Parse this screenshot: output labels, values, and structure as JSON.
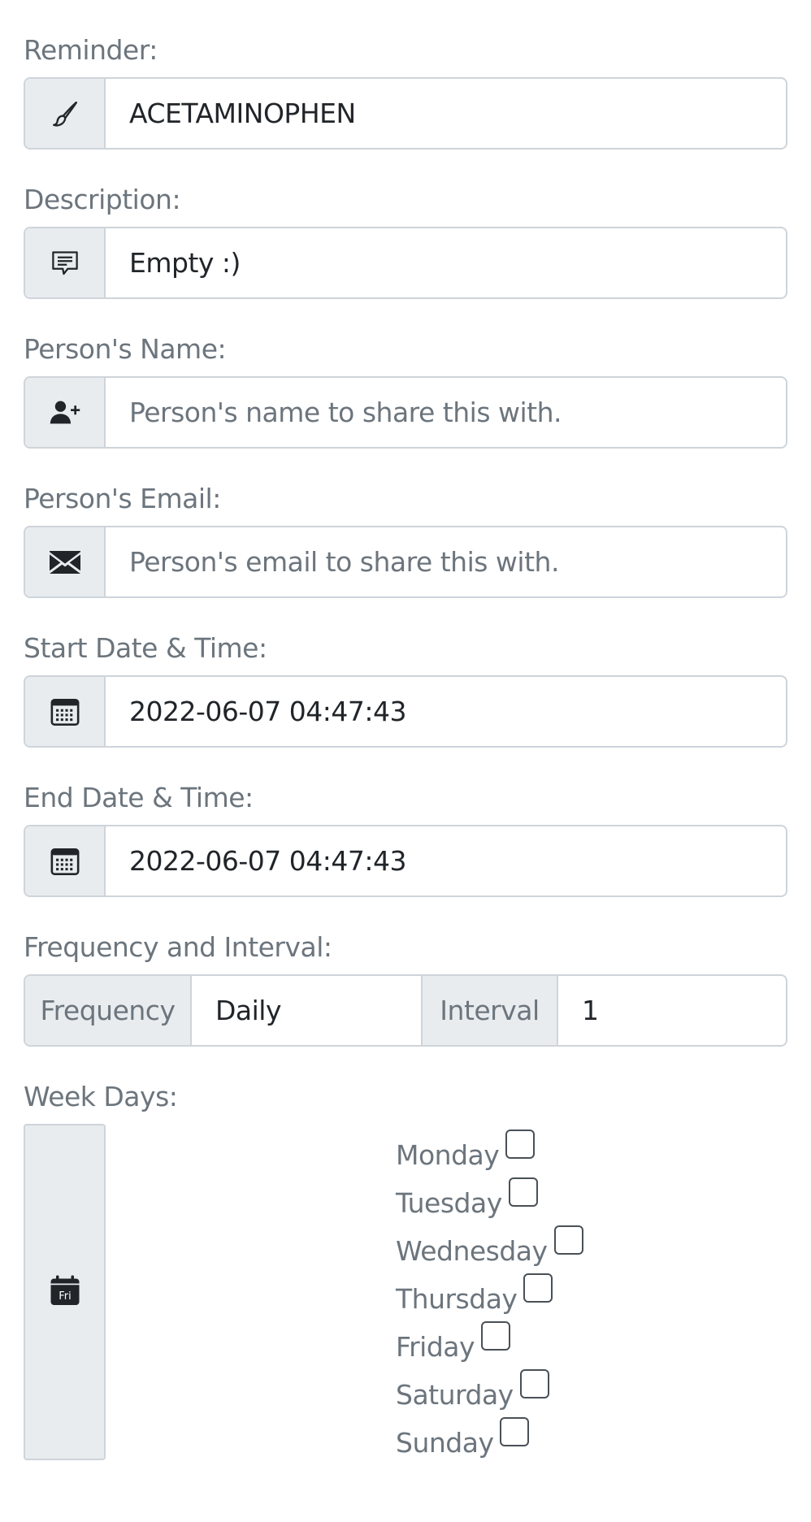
{
  "form": {
    "reminder": {
      "label": "Reminder:",
      "icon": "brush-icon",
      "value": "ACETAMINOPHEN",
      "placeholder": ""
    },
    "description": {
      "label": "Description:",
      "icon": "chat-icon",
      "value": "Empty :)",
      "placeholder": ""
    },
    "person_name": {
      "label": "Person's Name:",
      "icon": "person-plus-icon",
      "value": "",
      "placeholder": "Person's name to share this with."
    },
    "person_email": {
      "label": "Person's Email:",
      "icon": "envelope-icon",
      "value": "",
      "placeholder": "Person's email to share this with."
    },
    "start": {
      "label": "Start Date & Time:",
      "icon": "calendar-icon",
      "value": "2022-06-07 04:47:43",
      "placeholder": ""
    },
    "end": {
      "label": "End Date & Time:",
      "icon": "calendar-icon",
      "value": "2022-06-07 04:47:43",
      "placeholder": ""
    },
    "frequency_interval": {
      "label": "Frequency and Interval:",
      "frequency_label": "Frequency",
      "frequency_value": "Daily",
      "interval_label": "Interval",
      "interval_value": "1"
    },
    "week_days": {
      "label": "Week Days:",
      "icon": "calendar-day-icon",
      "icon_text": "Fri",
      "days": [
        {
          "name": "Monday",
          "checked": false
        },
        {
          "name": "Tuesday",
          "checked": false
        },
        {
          "name": "Wednesday",
          "checked": false
        },
        {
          "name": "Thursday",
          "checked": false
        },
        {
          "name": "Friday",
          "checked": false
        },
        {
          "name": "Saturday",
          "checked": false
        },
        {
          "name": "Sunday",
          "checked": false
        }
      ]
    }
  },
  "colors": {
    "addon_bg": "#e9ecef",
    "border": "#ced4da",
    "label_text": "#6c757d",
    "value_text": "#212529"
  }
}
